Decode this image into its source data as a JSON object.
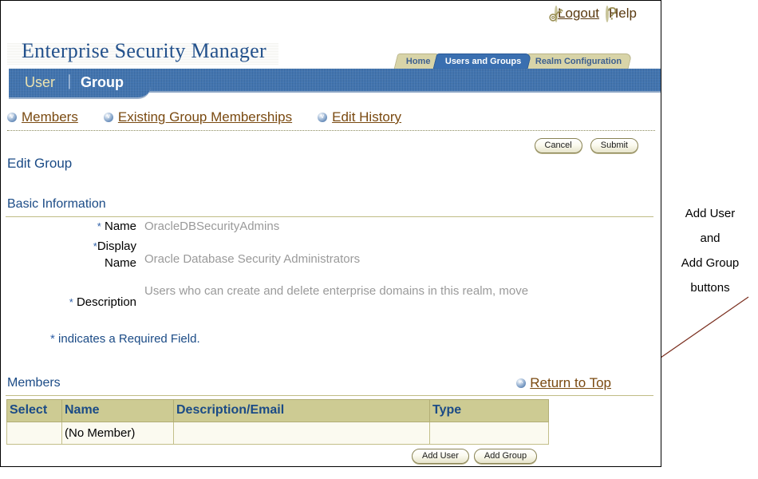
{
  "app": {
    "brand_title": "Enterprise Security Manager"
  },
  "global_buttons": [
    {
      "label": "Logout",
      "icon": "key-icon"
    },
    {
      "label": "Help",
      "icon": "question-mark-icon"
    }
  ],
  "top_tabs": [
    {
      "label": "Home",
      "active": false
    },
    {
      "label": "Users and Groups",
      "active": true
    },
    {
      "label": "Realm Configuration",
      "active": false
    }
  ],
  "sub_tabs": {
    "user_label": "User",
    "separator": "|",
    "group_label": "Group"
  },
  "quick_nav": [
    {
      "label": "Members",
      "icon": "down-arrow-bullet-icon"
    },
    {
      "label": "Existing Group Memberships",
      "icon": "down-arrow-bullet-icon"
    },
    {
      "label": "Edit History",
      "icon": "down-arrow-bullet-icon"
    }
  ],
  "form_buttons": {
    "cancel_label": "Cancel",
    "submit_label": "Submit"
  },
  "page": {
    "title": "Edit Group",
    "section_title": "Basic Information",
    "required_note_star": "*",
    "required_note_text": "indicates a Required Field."
  },
  "fields": {
    "name": {
      "star": "*",
      "label": "Name",
      "value": "OracleDBSecurityAdmins"
    },
    "display_name": {
      "star": "*",
      "label_line1": "Display",
      "label_line2": "Name",
      "value": "Oracle Database Security Administrators"
    },
    "description": {
      "star": "*",
      "label": "Description",
      "value": "Users who can  create and delete enterprise domains in this realm, move"
    }
  },
  "members": {
    "title": "Members",
    "return_to_top_label": "Return to Top",
    "return_to_top_icon": "up-arrow-bullet-icon",
    "columns": [
      "Select",
      "Name",
      "Description/Email",
      "Type"
    ],
    "rows": [
      {
        "select": "",
        "name": "(No Member)",
        "description": "",
        "type": ""
      }
    ],
    "buttons": {
      "add_user_label": "Add User",
      "add_group_label": "Add Group"
    }
  },
  "annotation": {
    "line1": "Add User",
    "line2": "and",
    "line3": "Add Group",
    "line4": "buttons"
  },
  "colors": {
    "brand_blue": "#23518c",
    "band_blue": "#3a70b0",
    "tab_khaki": "#d8d4a8",
    "table_header": "#cdcb93",
    "link_brown": "#7a4a11",
    "value_gray": "#9a9a9a"
  }
}
